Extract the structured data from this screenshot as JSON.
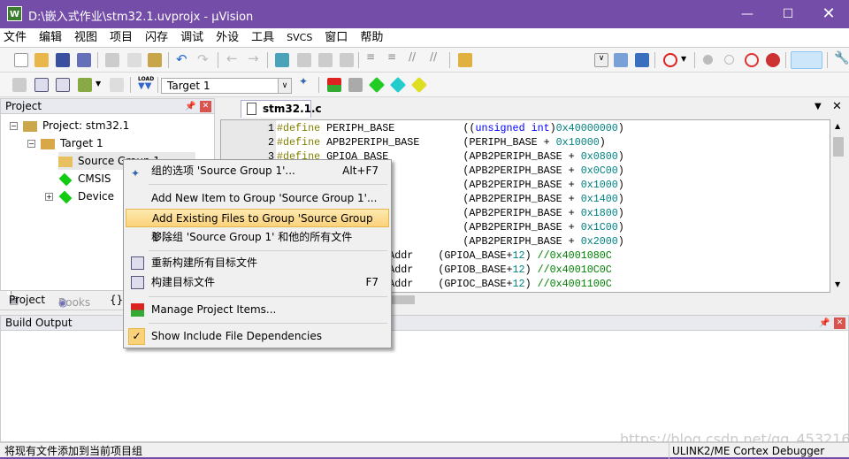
{
  "window": {
    "title": "D:\\嵌入式作业\\stm32.1.uvprojx - µVision",
    "logo": "W",
    "controls": [
      "minimize",
      "maximize",
      "close"
    ]
  },
  "menubar": [
    "文件",
    "编辑",
    "视图",
    "项目",
    "闪存",
    "调试",
    "外设",
    "工具",
    "SVCS",
    "窗口",
    "帮助"
  ],
  "toolbar2": {
    "target": "Target 1",
    "load_label": "LOAD"
  },
  "project_panel": {
    "title": "Project",
    "tree": [
      {
        "label": "Project: stm32.1",
        "icon": "project-icon"
      },
      {
        "label": "Target 1",
        "icon": "folder-open-icon"
      },
      {
        "label": "Source Group 1",
        "icon": "folder-icon"
      },
      {
        "label": "CMSIS",
        "icon": "component-icon"
      },
      {
        "label": "Device",
        "icon": "component-icon"
      }
    ],
    "tabs": [
      "Project",
      "Books",
      "{}"
    ]
  },
  "editor": {
    "tab": "stm32.1.c",
    "lines": [
      {
        "n": "1",
        "kw": "#define",
        "name": "PERIPH_BASE",
        "pre": "((",
        "ty": "unsigned int",
        "mid": ")",
        "num": "0x40000000",
        "post": ")"
      },
      {
        "n": "2",
        "kw": "#define",
        "name": "APB2PERIPH_BASE",
        "pre": "(PERIPH_BASE + ",
        "num": "0x10000",
        "post": ")"
      },
      {
        "n": "3",
        "kw": "#define",
        "name": "GPIOA_BASE",
        "pre": "(APB2PERIPH_BASE + ",
        "num": "0x0800",
        "post": ")"
      },
      {
        "pre": "(APB2PERIPH_BASE + ",
        "num": "0x0C00",
        "post": ")"
      },
      {
        "pre": "(APB2PERIPH_BASE + ",
        "num": "0x1000",
        "post": ")"
      },
      {
        "pre": "(APB2PERIPH_BASE + ",
        "num": "0x1400",
        "post": ")"
      },
      {
        "pre": "(APB2PERIPH_BASE + ",
        "num": "0x1800",
        "post": ")"
      },
      {
        "pre": "(APB2PERIPH_BASE + ",
        "num": "0x1C00",
        "post": ")"
      },
      {
        "pre": "(APB2PERIPH_BASE + ",
        "num": "0x2000",
        "post": ")"
      },
      {
        "name": "Addr",
        "pre": "(GPIOA_BASE+",
        "num": "12",
        "post": ") ",
        "comment": "//0x4001080C"
      },
      {
        "name": "Addr",
        "pre": "(GPIOB_BASE+",
        "num": "12",
        "post": ") ",
        "comment": "//0x40010C0C"
      },
      {
        "name": "Addr",
        "pre": "(GPIOC_BASE+",
        "num": "12",
        "post": ") ",
        "comment": "//0x4001100C"
      }
    ]
  },
  "build_output": {
    "title": "Build Output"
  },
  "context_menu": [
    {
      "label": "组的选项 'Source Group 1'...",
      "shortcut": "Alt+F7",
      "icon": "magic-wand-icon"
    },
    {
      "label": "Add New  Item to Group 'Source Group 1'..."
    },
    {
      "label": "Add Existing Files to Group 'Source Group 1'...",
      "highlighted": true
    },
    {
      "label": "移除组 'Source Group 1' 和他的所有文件"
    },
    {
      "label": "重新构建所有目标文件",
      "icon": "rebuild-icon"
    },
    {
      "label": "构建目标文件",
      "shortcut": "F7",
      "icon": "build-icon"
    },
    {
      "label": "Manage Project Items...",
      "icon": "manage-items-icon"
    },
    {
      "label": "Show Include File Dependencies",
      "checked": true
    }
  ],
  "status": {
    "message": "将现有文件添加到当前项目组",
    "debugger": "ULINK2/ME Cortex Debugger",
    "watermark": "https://blog.csdn.net/qq_45321687"
  },
  "colors": {
    "titlebar": "#744da9",
    "highlight": "#fbd27a",
    "keyword": "#808000",
    "type": "#0000ff",
    "number": "#008080",
    "comment": "#008000"
  }
}
